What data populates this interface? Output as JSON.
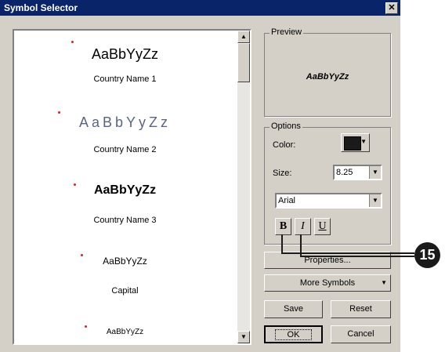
{
  "window": {
    "title": "Symbol Selector",
    "close_glyph": "✕"
  },
  "symbols": [
    {
      "sample": "AaBbYyZz",
      "label": "Country Name 1"
    },
    {
      "sample": "AaBbYyZz",
      "label": "Country Name 2"
    },
    {
      "sample": "AaBbYyZz",
      "label": "Country Name 3"
    },
    {
      "sample": "AaBbYyZz",
      "label": "Capital"
    },
    {
      "sample": "AaBbYyZz",
      "label": ""
    }
  ],
  "preview": {
    "legend": "Preview",
    "text": "AaBbYyZz"
  },
  "options": {
    "legend": "Options",
    "color_label": "Color:",
    "color_value": "#1a1a1a",
    "size_label": "Size:",
    "size_value": "8.25",
    "font_value": "Arial",
    "bold_label": "B",
    "italic_label": "I",
    "underline_label": "U"
  },
  "buttons": {
    "properties": "Properties...",
    "more_symbols": "More Symbols",
    "save": "Save",
    "reset": "Reset",
    "ok": "OK",
    "cancel": "Cancel"
  },
  "callout": {
    "number": "15"
  }
}
